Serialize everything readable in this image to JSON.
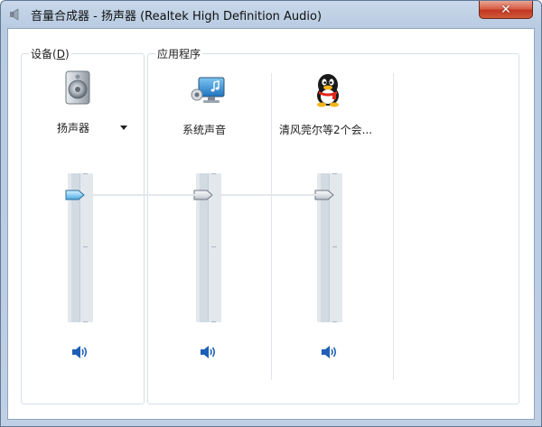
{
  "window": {
    "title": "音量合成器 - 扬声器 (Realtek High Definition Audio)",
    "close_symbol": "✕",
    "accent": "#1d5fb5"
  },
  "device_group": {
    "label_prefix": "设备(",
    "label_hotkey": "D",
    "label_suffix": ")",
    "device": {
      "name": "扬声器",
      "icon": "speaker-icon",
      "volume_percent": 87,
      "mute_icon": "speaker-volume-icon"
    }
  },
  "apps_group": {
    "label": "应用程序",
    "apps": [
      {
        "name": "系统声音",
        "icon": "system-sounds-icon",
        "volume_percent": 87,
        "mute_icon": "speaker-volume-icon"
      },
      {
        "name": "清风莞尔等2个会...",
        "icon": "qq-penguin-icon",
        "volume_percent": 87,
        "mute_icon": "speaker-volume-icon"
      }
    ]
  }
}
